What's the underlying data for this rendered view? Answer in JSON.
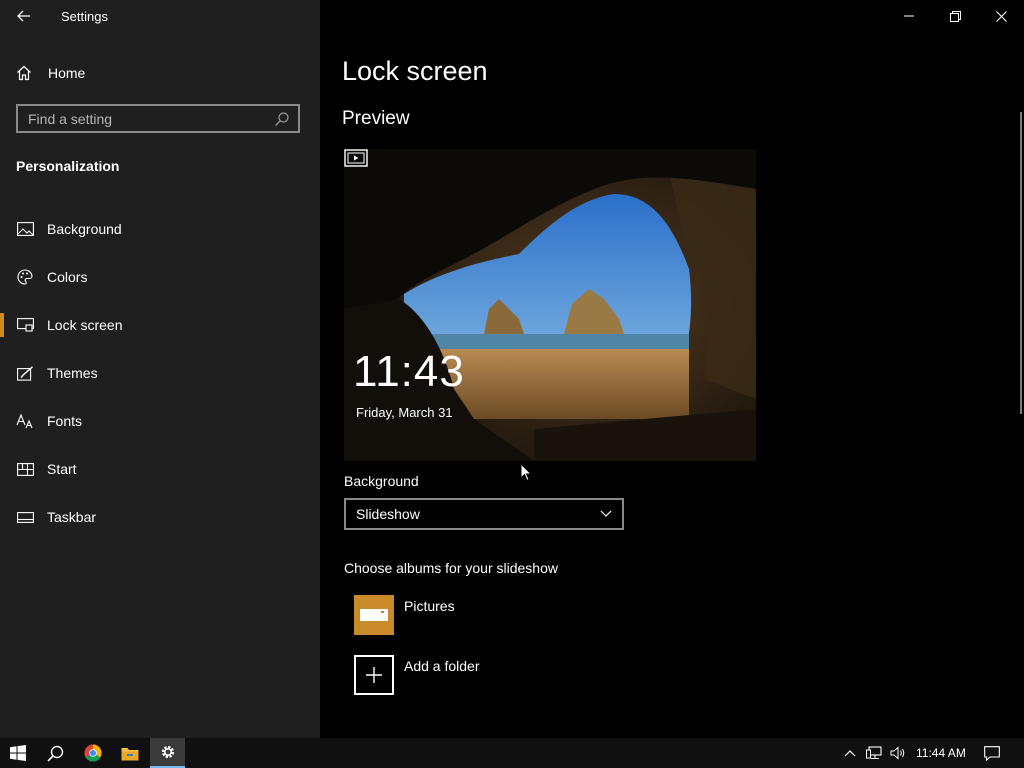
{
  "window": {
    "title": "Settings",
    "controls": [
      "minimize-icon",
      "restore-icon",
      "close-icon"
    ]
  },
  "sidebar": {
    "home_label": "Home",
    "search_placeholder": "Find a setting",
    "section": "Personalization",
    "items": [
      {
        "label": "Background",
        "icon": "picture-icon",
        "active": false
      },
      {
        "label": "Colors",
        "icon": "palette-icon",
        "active": false
      },
      {
        "label": "Lock screen",
        "icon": "lock-screen-icon",
        "active": true
      },
      {
        "label": "Themes",
        "icon": "brush-icon",
        "active": false
      },
      {
        "label": "Fonts",
        "icon": "font-icon",
        "active": false
      },
      {
        "label": "Start",
        "icon": "start-icon",
        "active": false
      },
      {
        "label": "Taskbar",
        "icon": "taskbar-icon",
        "active": false
      }
    ]
  },
  "main": {
    "title": "Lock screen",
    "preview_heading": "Preview",
    "preview": {
      "time": "11:43",
      "date": "Friday, March 31"
    },
    "background_label": "Background",
    "background_value": "Slideshow",
    "albums_label": "Choose albums for your slideshow",
    "albums": [
      {
        "name": "Pictures",
        "icon": "pictures-folder-icon"
      },
      {
        "name": "Add a folder",
        "icon": "add-icon"
      }
    ]
  },
  "taskbar": {
    "apps": [
      "windows-start-icon",
      "search-icon",
      "chrome-icon",
      "file-explorer-icon",
      "settings-icon"
    ],
    "tray": [
      "chevron-up-icon",
      "network-icon",
      "volume-icon"
    ],
    "time": "11:44 AM",
    "notification_icon": "notification-icon"
  },
  "colors": {
    "accent": "#d18a1b",
    "sidebar_bg": "#1f1f1f",
    "main_bg": "#000000",
    "taskbar_bg": "#101010",
    "folder": "#c98a2a"
  }
}
